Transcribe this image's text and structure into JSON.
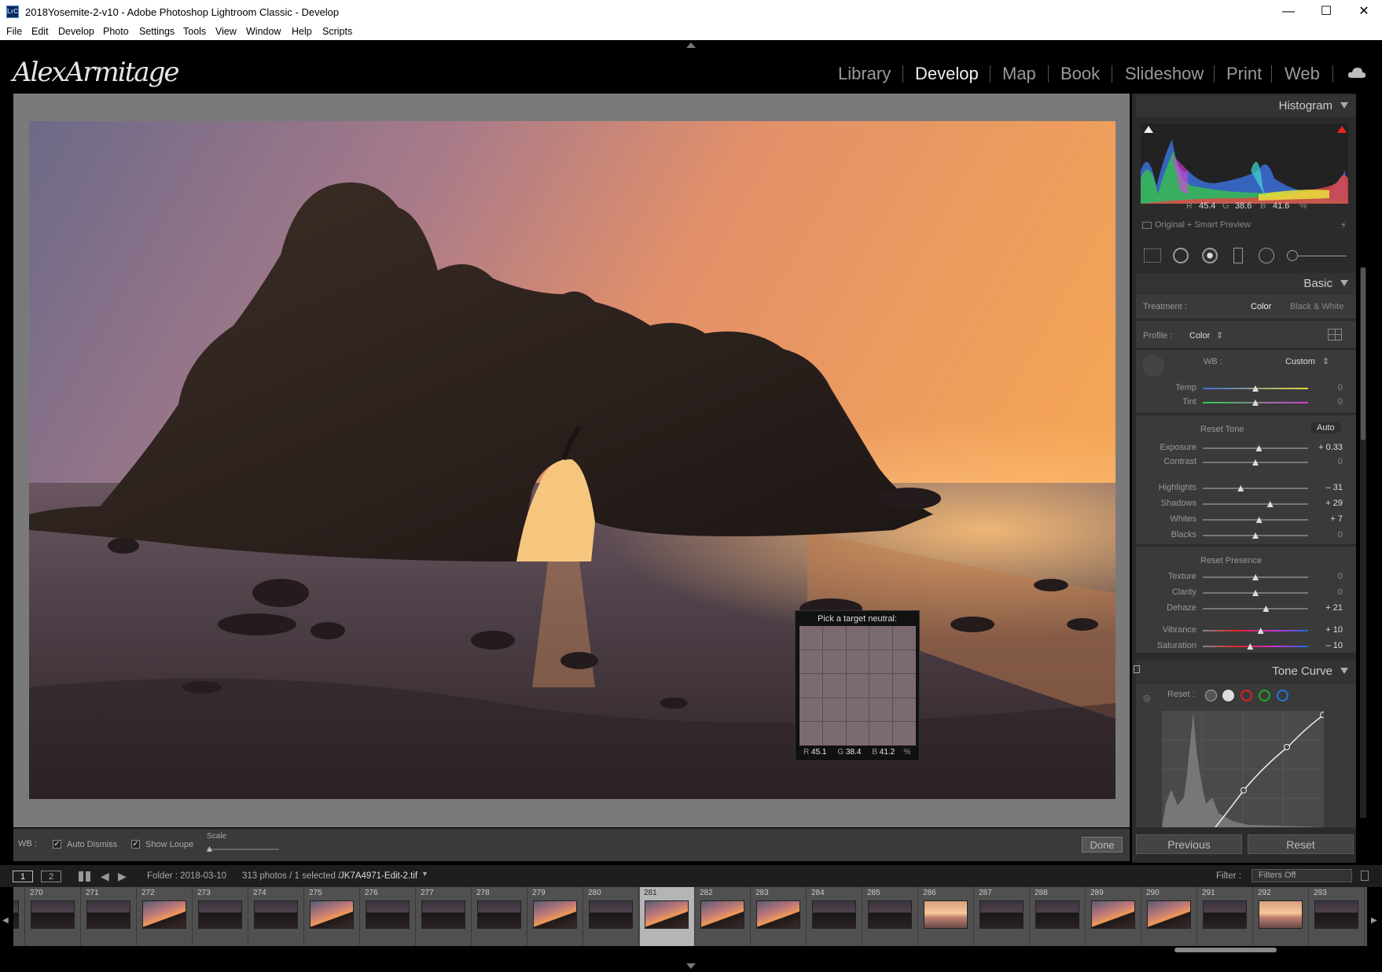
{
  "window": {
    "title": "2018Yosemite-2-v10 - Adobe Photoshop Lightroom Classic - Develop",
    "app_icon": "LrC",
    "minimize": "—",
    "maximize": "☐",
    "close": "✕"
  },
  "menu": [
    "File",
    "Edit",
    "Develop",
    "Photo",
    "Settings",
    "Tools",
    "View",
    "Window",
    "Help",
    "Scripts"
  ],
  "identity_plate": "AlexArmitage",
  "modules": [
    "Library",
    "Develop",
    "Map",
    "Book",
    "Slideshow",
    "Print",
    "Web"
  ],
  "active_module": "Develop",
  "loupe": {
    "title": "Pick a target neutral:",
    "r": "45.1",
    "g": "38.4",
    "b": "41.2",
    "unit": "%",
    "r_label": "R",
    "g_label": "G",
    "b_label": "B"
  },
  "toolbar": {
    "wb_label": "WB :",
    "auto_dismiss": "Auto Dismiss",
    "show_loupe": "Show Loupe",
    "scale": "Scale",
    "done": "Done"
  },
  "histogram": {
    "title": "Histogram",
    "r_label": "R",
    "r": "45.4",
    "g_label": "G",
    "g": "38.6",
    "b_label": "B",
    "b": "41.6",
    "unit": "%",
    "preview": "Original + Smart Preview"
  },
  "basic": {
    "title": "Basic",
    "treatment_label": "Treatment :",
    "treatment_color": "Color",
    "treatment_bw": "Black & White",
    "profile_label": "Profile :",
    "profile_value": "Color",
    "wb_label": "WB :",
    "wb_value": "Custom",
    "reset_tone": "Reset Tone",
    "auto": "Auto",
    "reset_presence": "Reset Presence",
    "sliders": [
      {
        "label": "Temp",
        "value": "0",
        "pos": 0.5
      },
      {
        "label": "Tint",
        "value": "0",
        "pos": 0.5
      },
      {
        "label": "Exposure",
        "value": "+ 0.33",
        "pos": 0.533
      },
      {
        "label": "Contrast",
        "value": "0",
        "pos": 0.5
      },
      {
        "label": "Highlights",
        "value": "– 31",
        "pos": 0.36
      },
      {
        "label": "Shadows",
        "value": "+ 29",
        "pos": 0.64
      },
      {
        "label": "Whites",
        "value": "+ 7",
        "pos": 0.535
      },
      {
        "label": "Blacks",
        "value": "0",
        "pos": 0.5
      },
      {
        "label": "Texture",
        "value": "0",
        "pos": 0.5
      },
      {
        "label": "Clarity",
        "value": "0",
        "pos": 0.5
      },
      {
        "label": "Dehaze",
        "value": "+ 21",
        "pos": 0.6
      },
      {
        "label": "Vibrance",
        "value": "+ 10",
        "pos": 0.55
      },
      {
        "label": "Saturation",
        "value": "– 10",
        "pos": 0.45
      }
    ]
  },
  "tone_curve": {
    "title": "Tone Curve",
    "reset": "Reset :"
  },
  "buttons": {
    "previous": "Previous",
    "reset": "Reset"
  },
  "filmstrip_bar": {
    "view1": "1",
    "view2": "2",
    "folder": "Folder : 2018-03-10",
    "count": "313 photos / 1 selected /",
    "file": "JK7A4971-Edit-2.tif",
    "filter_label": "Filter :",
    "filter_value": "Filters Off"
  },
  "filmstrip": [
    {
      "n": "",
      "kind": "dark"
    },
    {
      "n": "270",
      "kind": "dark"
    },
    {
      "n": "271",
      "kind": "dark"
    },
    {
      "n": "272",
      "kind": "warm"
    },
    {
      "n": "273",
      "kind": "dark"
    },
    {
      "n": "274",
      "kind": "dark"
    },
    {
      "n": "275",
      "kind": "warm"
    },
    {
      "n": "276",
      "kind": "dark"
    },
    {
      "n": "277",
      "kind": "dark"
    },
    {
      "n": "278",
      "kind": "dark"
    },
    {
      "n": "279",
      "kind": "warm"
    },
    {
      "n": "280",
      "kind": "dark"
    },
    {
      "n": "281",
      "kind": "warm",
      "selected": true
    },
    {
      "n": "282",
      "kind": "warm"
    },
    {
      "n": "283",
      "kind": "warm"
    },
    {
      "n": "284",
      "kind": "dark"
    },
    {
      "n": "285",
      "kind": "dark"
    },
    {
      "n": "286",
      "kind": "bright"
    },
    {
      "n": "287",
      "kind": "dark"
    },
    {
      "n": "288",
      "kind": "dark"
    },
    {
      "n": "289",
      "kind": "warm"
    },
    {
      "n": "290",
      "kind": "warm"
    },
    {
      "n": "291",
      "kind": "dark"
    },
    {
      "n": "292",
      "kind": "bright"
    },
    {
      "n": "293",
      "kind": "dark"
    }
  ]
}
